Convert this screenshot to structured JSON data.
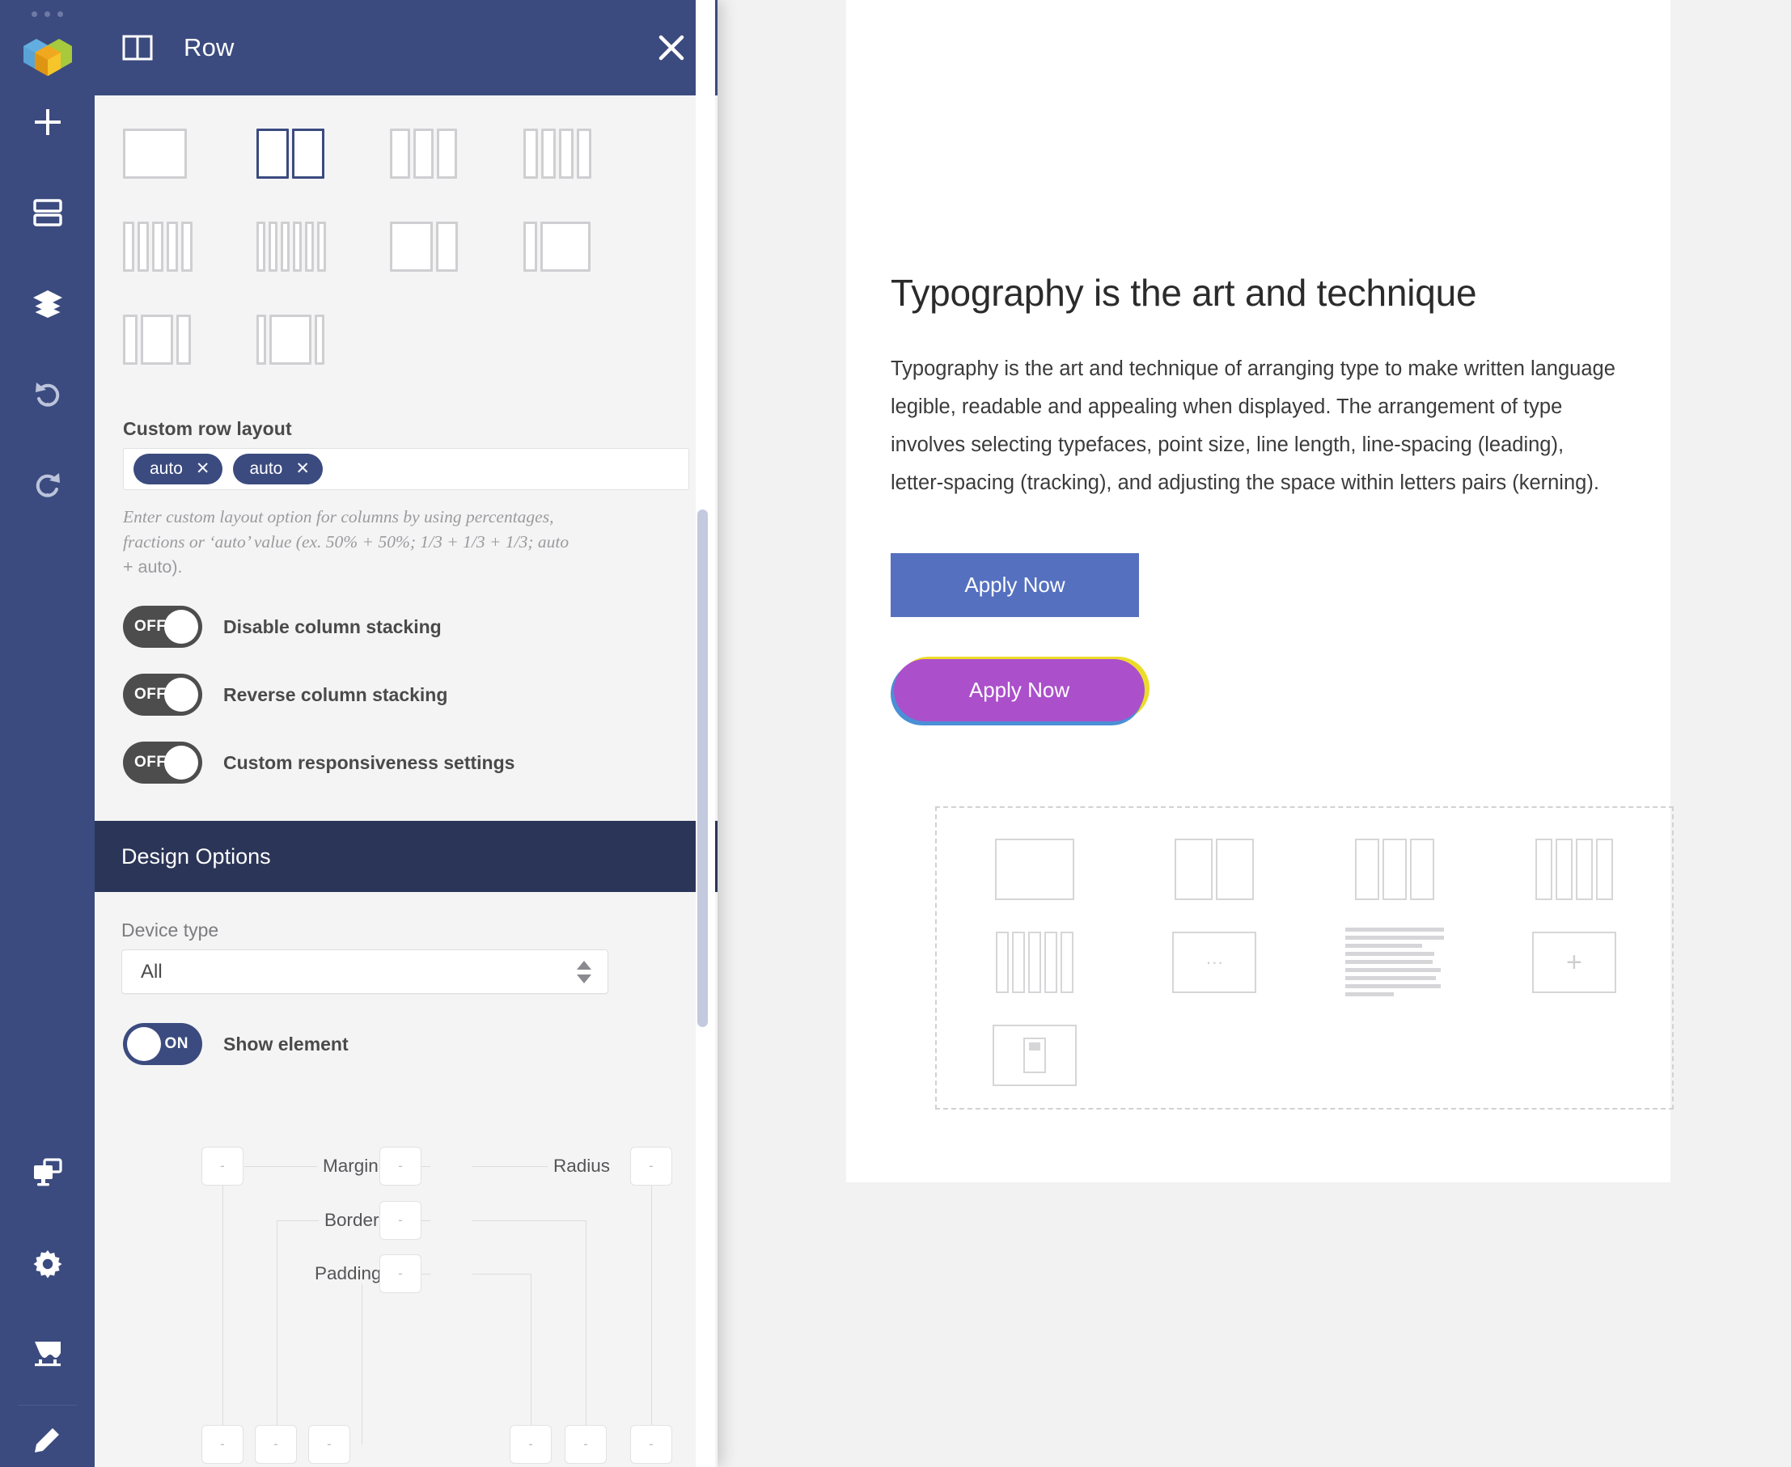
{
  "rail": {
    "logo_name": "visual-composer-logo",
    "items": [
      {
        "name": "add-element-icon",
        "label": "Add Element"
      },
      {
        "name": "templates-icon",
        "label": "Templates"
      },
      {
        "name": "layers-icon",
        "label": "Layers"
      },
      {
        "name": "undo-icon",
        "label": "Undo"
      },
      {
        "name": "redo-icon",
        "label": "Redo"
      }
    ],
    "bottom_items": [
      {
        "name": "responsive-view-icon",
        "label": "Responsive View"
      },
      {
        "name": "settings-gear-icon",
        "label": "Settings"
      },
      {
        "name": "theme-builder-icon",
        "label": "Theme Builder"
      },
      {
        "name": "edit-pencil-icon",
        "label": "Edit"
      }
    ]
  },
  "panel": {
    "title": "Row",
    "title_icon": "row-two-column-icon",
    "close_label": "✕",
    "layouts": [
      {
        "name": "layout-1-col",
        "cols": [
          1
        ],
        "selected": false
      },
      {
        "name": "layout-2-col",
        "cols": [
          1,
          1
        ],
        "selected": true
      },
      {
        "name": "layout-3-col",
        "cols": [
          1,
          1,
          1
        ],
        "selected": false
      },
      {
        "name": "layout-4-col",
        "cols": [
          1,
          1,
          1,
          1
        ],
        "selected": false
      },
      {
        "name": "layout-5-col",
        "cols": [
          1,
          1,
          1,
          1,
          1
        ],
        "selected": false
      },
      {
        "name": "layout-6-col",
        "cols": [
          1,
          1,
          1,
          1,
          1,
          1
        ],
        "selected": false
      },
      {
        "name": "layout-2-col-wide-left",
        "cols": [
          2,
          1
        ],
        "selected": false
      },
      {
        "name": "layout-2-col-wide-right",
        "cols": [
          1,
          3
        ],
        "selected": false
      },
      {
        "name": "layout-3-col-wide-center",
        "cols": [
          1,
          2,
          1
        ],
        "selected": false
      },
      {
        "name": "layout-3-col-wider-center",
        "cols": [
          1,
          4,
          1
        ],
        "selected": false
      }
    ],
    "custom_row_layout_label": "Custom row layout",
    "tokens": [
      {
        "value": "auto",
        "remove": "✕"
      },
      {
        "value": "auto",
        "remove": "✕"
      }
    ],
    "hint_line1": "Enter custom layout option for columns by using percentages,",
    "hint_line2": "fractions or ‘auto’ value (ex. 50% + 50%; 1/3 + 1/3 + 1/3; auto",
    "hint_line3": "+ auto).",
    "toggles": [
      {
        "name": "disable-column-stacking-toggle",
        "state": "OFF",
        "on": false,
        "label": "Disable column stacking"
      },
      {
        "name": "reverse-column-stacking-toggle",
        "state": "OFF",
        "on": false,
        "label": "Reverse column stacking"
      },
      {
        "name": "custom-responsiveness-toggle",
        "state": "OFF",
        "on": false,
        "label": "Custom responsiveness settings"
      }
    ],
    "design_options_title": "Design Options",
    "device_type_label": "Device type",
    "device_type_value": "All",
    "show_element_toggle": {
      "state": "ON",
      "on": true,
      "label": "Show element"
    },
    "box_model": {
      "margin_label": "Margin",
      "radius_label": "Radius",
      "border_label": "Border",
      "padding_label": "Padding",
      "placeholder": "-"
    }
  },
  "canvas": {
    "heading": "Typography is the art and technique",
    "paragraph": "Typography is the art and technique of arranging type to make written language legible, readable and appealing when displayed. The arrangement of type involves selecting typefaces, point size, line length, line-spacing (leading), letter-spacing (tracking), and adjusting the space within letters pairs (kerning).",
    "button_primary": "Apply Now",
    "button_fancy": "Apply Now",
    "dropzone_items": [
      {
        "name": "dz-single-column",
        "type": "cols",
        "cols": [
          1
        ]
      },
      {
        "name": "dz-two-columns",
        "type": "cols",
        "cols": [
          1,
          1
        ]
      },
      {
        "name": "dz-three-columns",
        "type": "cols",
        "cols": [
          1,
          1,
          1
        ]
      },
      {
        "name": "dz-four-columns",
        "type": "cols",
        "cols": [
          1,
          1,
          1,
          1
        ]
      },
      {
        "name": "dz-five-columns",
        "type": "cols",
        "cols": [
          1,
          1,
          1,
          1,
          1
        ]
      },
      {
        "name": "dz-more-options",
        "type": "dots",
        "glyph": "···"
      },
      {
        "name": "dz-text-block",
        "type": "lines"
      },
      {
        "name": "dz-add-element",
        "type": "plus",
        "glyph": "+"
      },
      {
        "name": "dz-image-block",
        "type": "image"
      }
    ]
  },
  "colors": {
    "rail_bg": "#3b4b7f",
    "panel_head_bg": "#3b4b7f",
    "design_options_bg": "#2b3558",
    "token_bg": "#3b4b7f",
    "toggle_off_bg": "#4d4d4d",
    "toggle_on_bg": "#3b4b7f",
    "button_primary_bg": "#5570bf",
    "button_fancy_bg": "#ab4fcb",
    "button_fancy_outline_yellow": "#ecdc2a",
    "button_fancy_outline_blue": "#4b8fd6",
    "scrollbar_thumb": "#c3cade",
    "canvas_bg": "#f2f2f2",
    "page_bg": "#ffffff"
  }
}
